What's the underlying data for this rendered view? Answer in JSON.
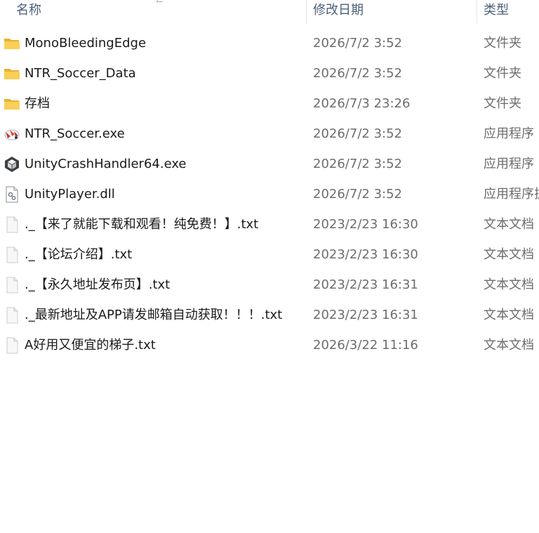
{
  "columns": {
    "name": "名称",
    "date_modified": "修改日期",
    "type": "类型"
  },
  "files": [
    {
      "name": "MonoBleedingEdge",
      "date": "2026/7/2 3:52",
      "type": "文件夹",
      "icon": "folder-icon"
    },
    {
      "name": "NTR_Soccer_Data",
      "date": "2026/7/2 3:52",
      "type": "文件夹",
      "icon": "folder-icon"
    },
    {
      "name": "存档",
      "date": "2026/7/3 23:26",
      "type": "文件夹",
      "icon": "folder-icon"
    },
    {
      "name": "NTR_Soccer.exe",
      "date": "2026/7/2 3:52",
      "type": "应用程序",
      "icon": "game-app-icon"
    },
    {
      "name": "UnityCrashHandler64.exe",
      "date": "2026/7/2 3:52",
      "type": "应用程序",
      "icon": "unity-app-icon"
    },
    {
      "name": "UnityPlayer.dll",
      "date": "2026/7/2 3:52",
      "type": "应用程序扩",
      "icon": "dll-file-icon"
    },
    {
      "name": "._【来了就能下载和观看！纯免费！】.txt",
      "date": "2023/2/23 16:30",
      "type": "文本文档",
      "icon": "text-file-icon"
    },
    {
      "name": "._【论坛介绍】.txt",
      "date": "2023/2/23 16:30",
      "type": "文本文档",
      "icon": "text-file-icon"
    },
    {
      "name": "._【永久地址发布页】.txt",
      "date": "2023/2/23 16:31",
      "type": "文本文档",
      "icon": "text-file-icon"
    },
    {
      "name": "._最新地址及APP请发邮箱自动获取！！！.txt",
      "date": "2023/2/23 16:31",
      "type": "文本文档",
      "icon": "text-file-icon"
    },
    {
      "name": "A好用又便宜的梯子.txt",
      "date": "2026/3/22 11:16",
      "type": "文本文档",
      "icon": "text-file-icon"
    }
  ],
  "colors": {
    "header_text": "#4c607a",
    "name_text": "#1a1a1a",
    "meta_text": "#6d6d6d",
    "folder": "#f5c242"
  }
}
